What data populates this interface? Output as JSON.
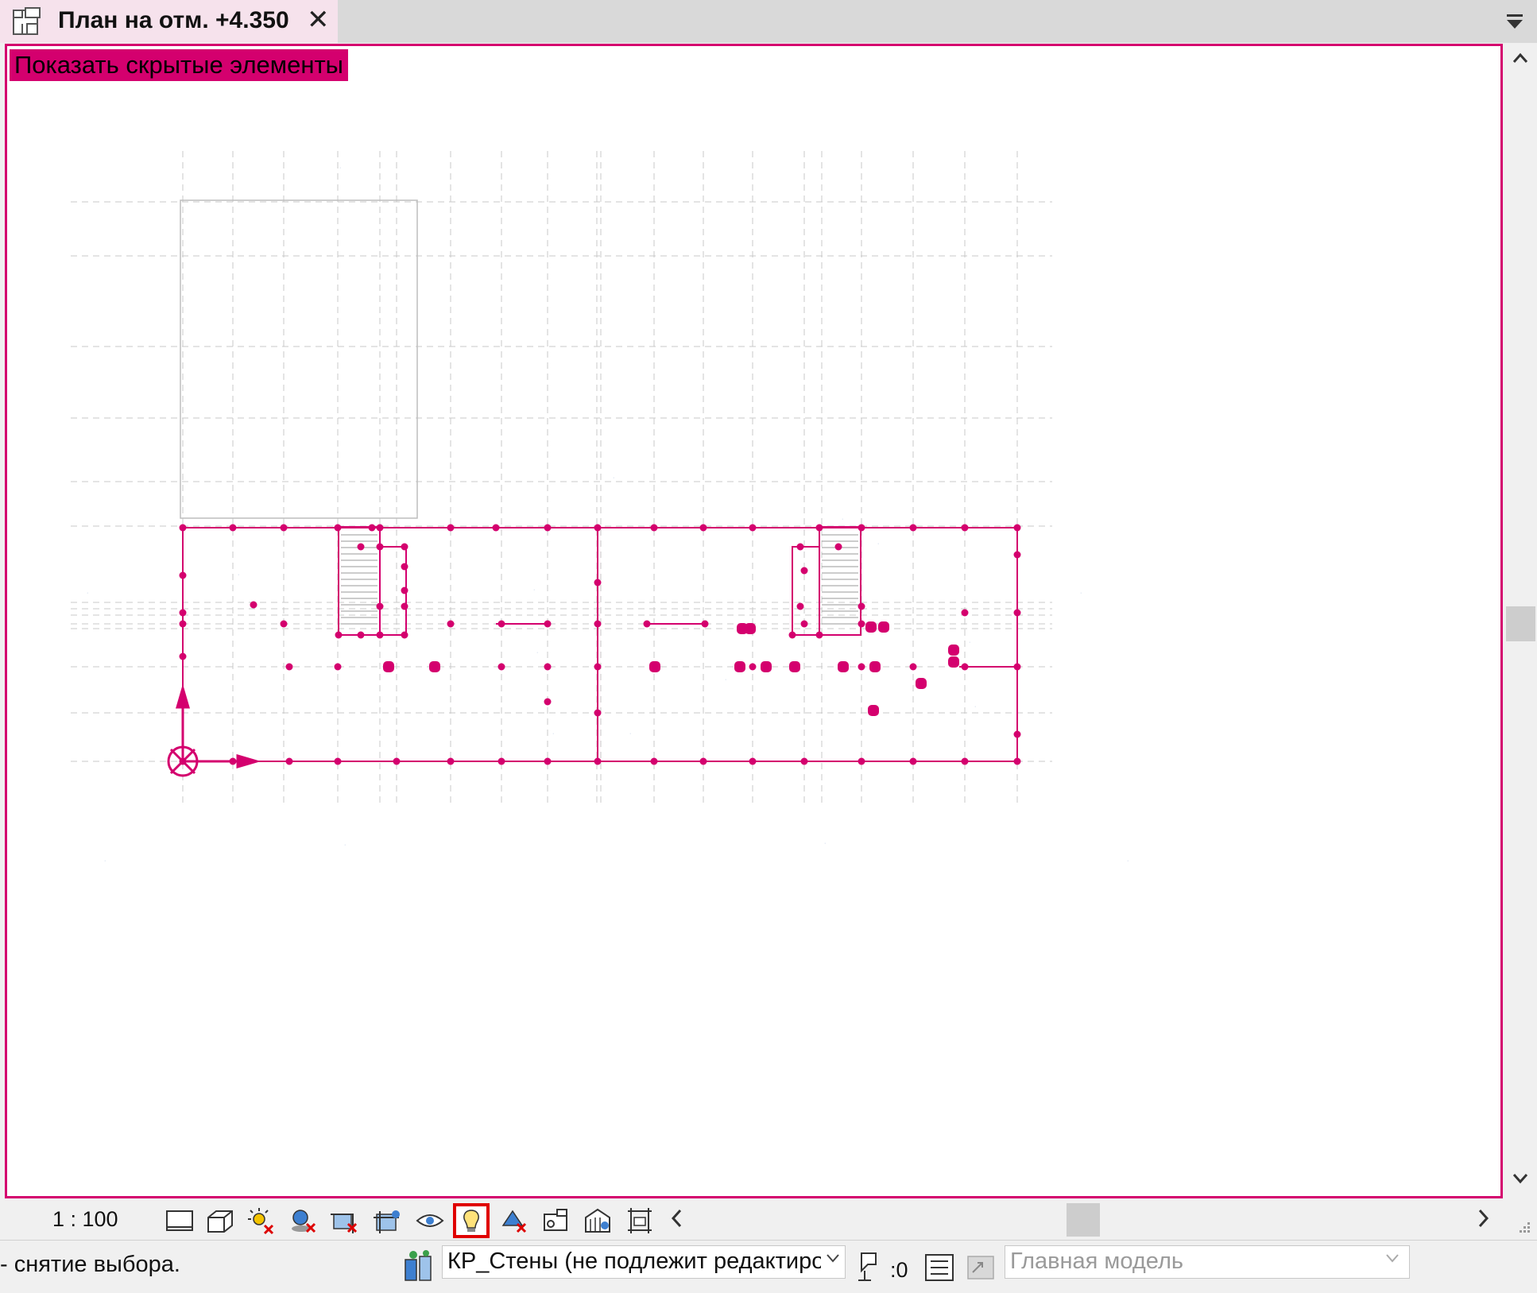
{
  "tab": {
    "title": "План на отм. +4.350",
    "close_icon": "close-icon",
    "view_icon": "floor-plan-icon"
  },
  "view": {
    "banner": "Показать скрытые элементы",
    "accent_color": "#d4006e"
  },
  "view_control_bar": {
    "scale": "1 : 100",
    "icons": [
      "detail-level-icon",
      "visual-style-icon",
      "sun-path-icon",
      "shadows-icon",
      "crop-view-icon",
      "show-crop-region-icon",
      "temporary-hide-isolate-icon",
      "reveal-hidden-elements-icon",
      "temporary-view-properties-icon",
      "analytical-model-icon",
      "highlight-displacement-icon",
      "reveal-constraints-icon"
    ],
    "active_icon": "reveal-hidden-elements-icon"
  },
  "status_bar": {
    "message": "- снятие выбора.",
    "workset": "КР_Стены (не подлежит редактированию)",
    "editing_requests": ":0",
    "design_option": "Главная модель"
  }
}
